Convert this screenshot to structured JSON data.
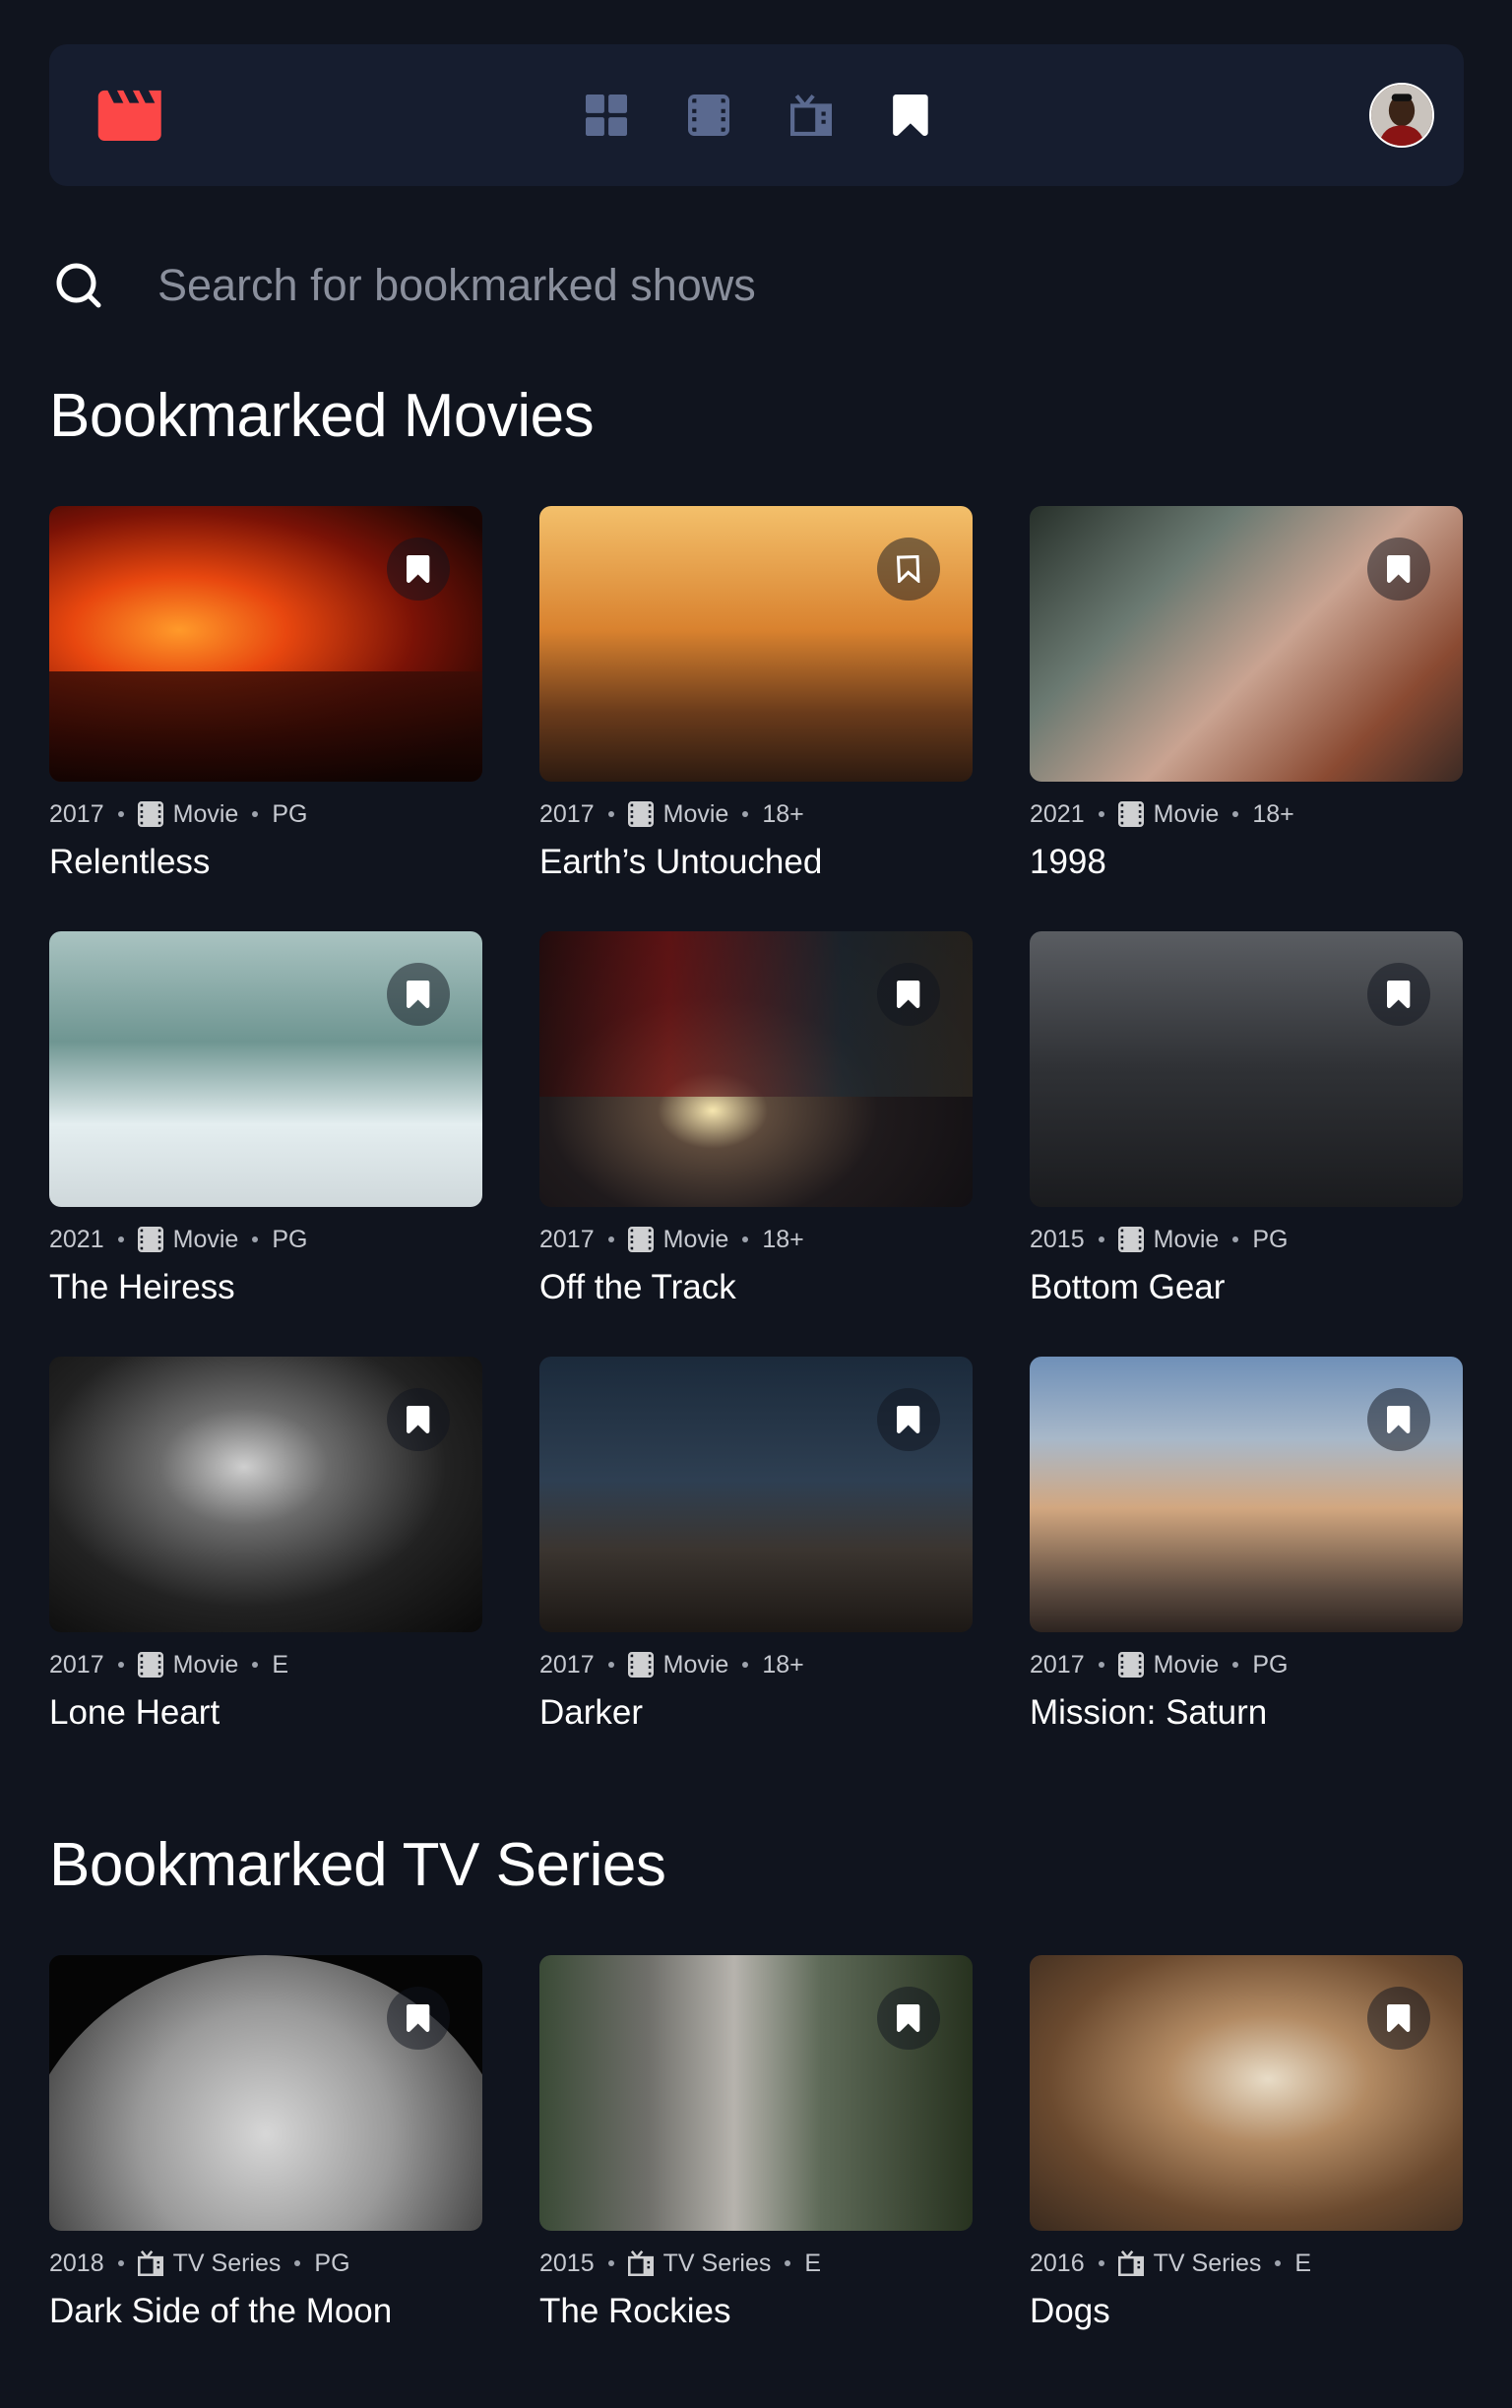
{
  "nav": {
    "logo_icon": "clapperboard-icon",
    "links": [
      {
        "name": "home",
        "icon": "grid-icon",
        "active": false
      },
      {
        "name": "movies",
        "icon": "film-icon",
        "active": false
      },
      {
        "name": "tv-series",
        "icon": "tv-icon",
        "active": false
      },
      {
        "name": "bookmarks",
        "icon": "bookmark-icon",
        "active": true
      }
    ],
    "avatar_icon": "user-avatar"
  },
  "search": {
    "placeholder": "Search for bookmarked shows",
    "value": ""
  },
  "colors": {
    "background": "#10141e",
    "surface": "#161d2f",
    "accent": "#fc4747",
    "nav_inactive": "#5a698f",
    "text": "#ffffff",
    "meta_text": "#c6c9d0"
  },
  "movies_section": {
    "title": "Bookmarked Movies",
    "items": [
      {
        "year": "2017",
        "category": "Movie",
        "rating": "PG",
        "title": "Relentless",
        "bookmarked": true
      },
      {
        "year": "2017",
        "category": "Movie",
        "rating": "18+",
        "title": "Earth’s Untouched",
        "bookmarked": false
      },
      {
        "year": "2021",
        "category": "Movie",
        "rating": "18+",
        "title": "1998",
        "bookmarked": true
      },
      {
        "year": "2021",
        "category": "Movie",
        "rating": "PG",
        "title": "The Heiress",
        "bookmarked": true
      },
      {
        "year": "2017",
        "category": "Movie",
        "rating": "18+",
        "title": "Off the Track",
        "bookmarked": true
      },
      {
        "year": "2015",
        "category": "Movie",
        "rating": "PG",
        "title": "Bottom Gear",
        "bookmarked": true
      },
      {
        "year": "2017",
        "category": "Movie",
        "rating": "E",
        "title": "Lone Heart",
        "bookmarked": true
      },
      {
        "year": "2017",
        "category": "Movie",
        "rating": "18+",
        "title": "Darker",
        "bookmarked": true
      },
      {
        "year": "2017",
        "category": "Movie",
        "rating": "PG",
        "title": "Mission: Saturn",
        "bookmarked": true
      }
    ]
  },
  "series_section": {
    "title": "Bookmarked TV Series",
    "items": [
      {
        "year": "2018",
        "category": "TV Series",
        "rating": "PG",
        "title": "Dark Side of the Moon",
        "bookmarked": true
      },
      {
        "year": "2015",
        "category": "TV Series",
        "rating": "E",
        "title": "The Rockies",
        "bookmarked": true
      },
      {
        "year": "2016",
        "category": "TV Series",
        "rating": "E",
        "title": "Dogs",
        "bookmarked": true
      }
    ]
  }
}
